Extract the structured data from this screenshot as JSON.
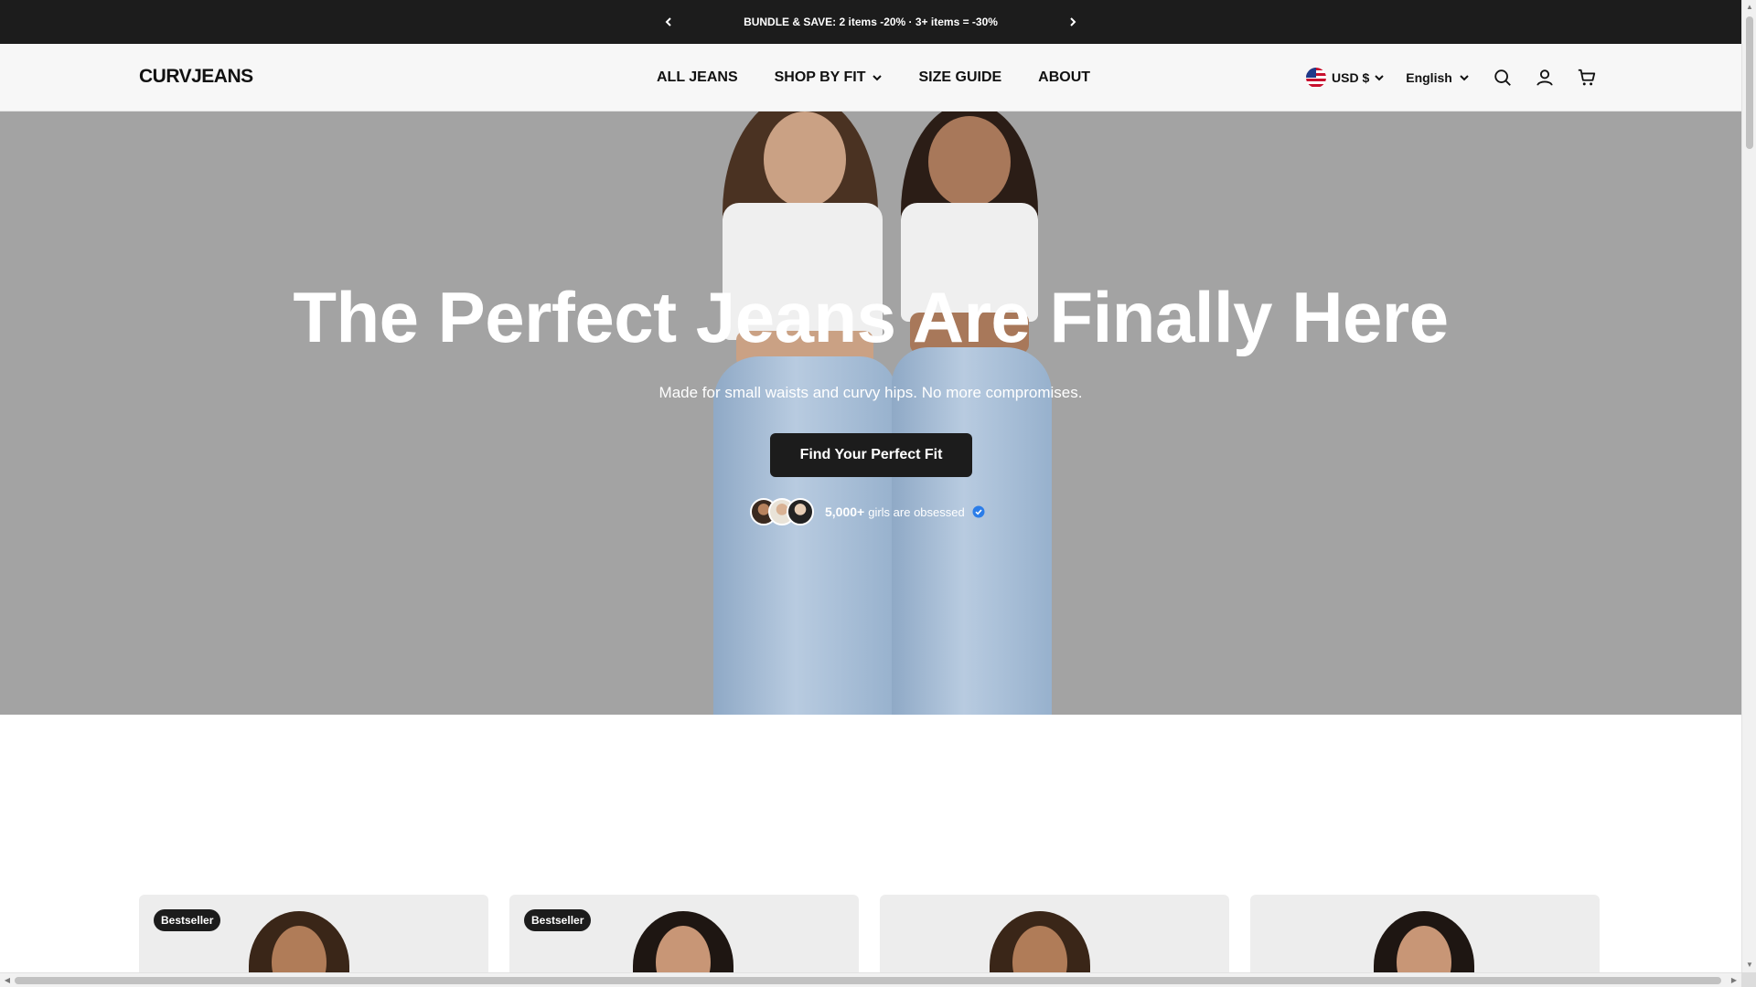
{
  "announcement": {
    "message": "BUNDLE & SAVE: 2 items -20% · 3+ items = -30%",
    "prev_icon": "chevron-left-icon",
    "next_icon": "chevron-right-icon"
  },
  "header": {
    "logo": "CURVJEANS",
    "nav": [
      {
        "label": "ALL JEANS",
        "has_dropdown": false
      },
      {
        "label": "SHOP BY FIT",
        "has_dropdown": true
      },
      {
        "label": "SIZE GUIDE",
        "has_dropdown": false
      },
      {
        "label": "ABOUT",
        "has_dropdown": false
      }
    ],
    "currency": "USD $",
    "language": "English",
    "icons": [
      "search-icon",
      "account-icon",
      "cart-icon"
    ]
  },
  "hero": {
    "title": "The Perfect Jeans Are Finally Here",
    "subtitle": "Made for small waists and curvy hips. No more compromises.",
    "cta": "Find Your Perfect Fit",
    "proof_count": "5,000+",
    "proof_text": "girls are obsessed",
    "background_color": "#a3a3a3"
  },
  "products": [
    {
      "badge": "Bestseller"
    },
    {
      "badge": "Bestseller"
    },
    {
      "badge": ""
    },
    {
      "badge": ""
    }
  ],
  "colors": {
    "announcement_bg": "#1c1c1c",
    "header_bg": "#f7f7f7",
    "cta_bg": "#1c1c1c",
    "verified": "#2b7de9"
  }
}
